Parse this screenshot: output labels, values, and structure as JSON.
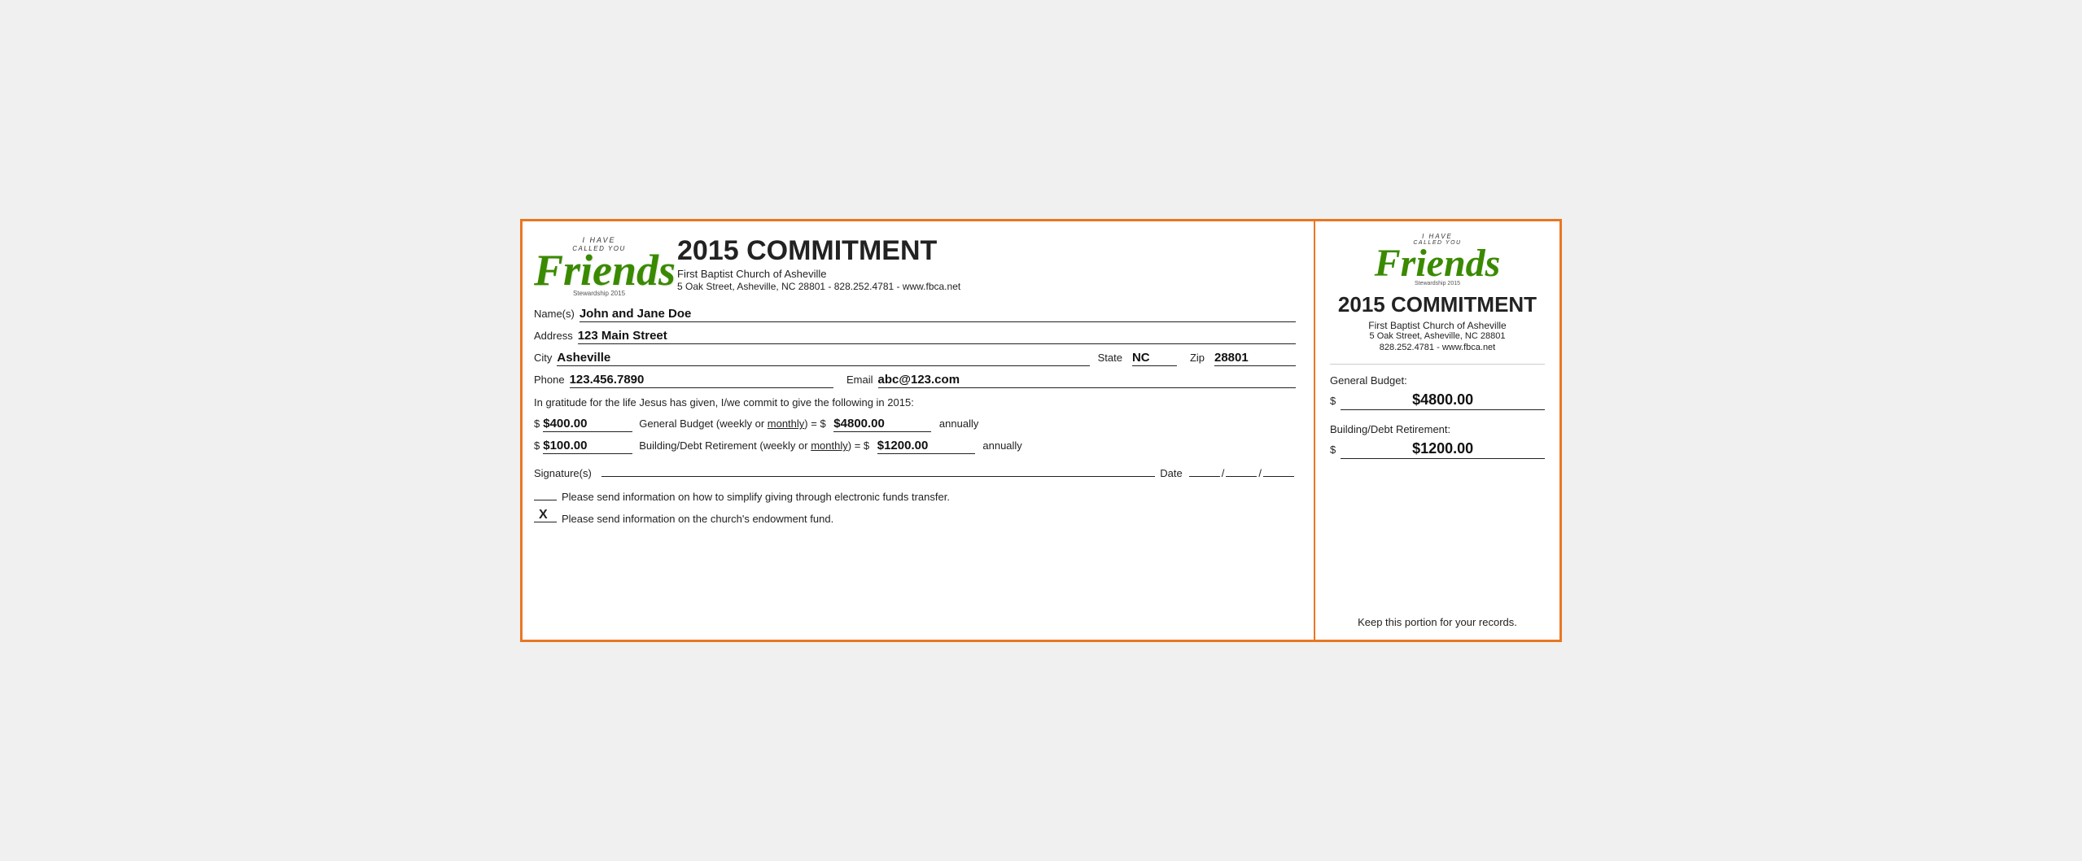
{
  "page": {
    "border_color": "#e87722"
  },
  "left": {
    "logo": {
      "i_have": "I HAVE",
      "called_you": "CALLED YOU",
      "friends": "Friends",
      "stewardship": "Stewardship 2015"
    },
    "header": {
      "title": "2015 COMMITMENT",
      "church_name": "First Baptist Church of Asheville",
      "address_line": "5 Oak Street, Asheville, NC  28801 - 828.252.4781 - www.fbca.net"
    },
    "fields": {
      "name_label": "Name(s)",
      "name_value": "John and Jane Doe",
      "address_label": "Address",
      "address_value": "123 Main Street",
      "city_label": "City",
      "city_value": "Asheville",
      "state_label": "State",
      "state_value": "NC",
      "zip_label": "Zip",
      "zip_value": "28801",
      "phone_label": "Phone",
      "phone_value": "123.456.7890",
      "email_label": "Email",
      "email_value": "abc@123.com"
    },
    "gratitude_text": "In gratitude for the life Jesus has given, I/we commit to give the following in 2015:",
    "commitments": {
      "general_amount": "$400.00",
      "general_desc_pre": "General Budget (weekly or ",
      "general_monthly": "monthly",
      "general_desc_post": ") = $",
      "general_annual": "$4800.00",
      "general_annually": "annually",
      "building_amount": "$100.00",
      "building_desc_pre": "Building/Debt Retirement (weekly or ",
      "building_monthly": "monthly",
      "building_desc_post": ") = $",
      "building_annual": "$1200.00",
      "building_annually": "annually"
    },
    "signature": {
      "label": "Signature(s)",
      "date_label": "Date",
      "slash1": "/",
      "slash2": "/"
    },
    "checkboxes": {
      "eft_checked": false,
      "eft_text": "Please send information on how to simplify giving through electronic funds transfer.",
      "endowment_checked": true,
      "endowment_mark": "X",
      "endowment_text": "Please send information on the church's endowment fund."
    }
  },
  "right": {
    "logo": {
      "i_have": "I HAVE",
      "called_you": "CALLED YOU",
      "friends": "Friends",
      "stewardship": "Stewardship 2015"
    },
    "header": {
      "title": "2015 COMMITMENT",
      "church_name": "First Baptist Church of Asheville",
      "address1": "5 Oak Street, Asheville, NC  28801",
      "address2": "828.252.4781 - www.fbca.net"
    },
    "general_budget": {
      "label": "General Budget:",
      "dollar": "$",
      "amount": "$4800.00"
    },
    "building_budget": {
      "label": "Building/Debt Retirement:",
      "dollar": "$",
      "amount": "$1200.00"
    },
    "keep_text": "Keep this portion for your records."
  }
}
